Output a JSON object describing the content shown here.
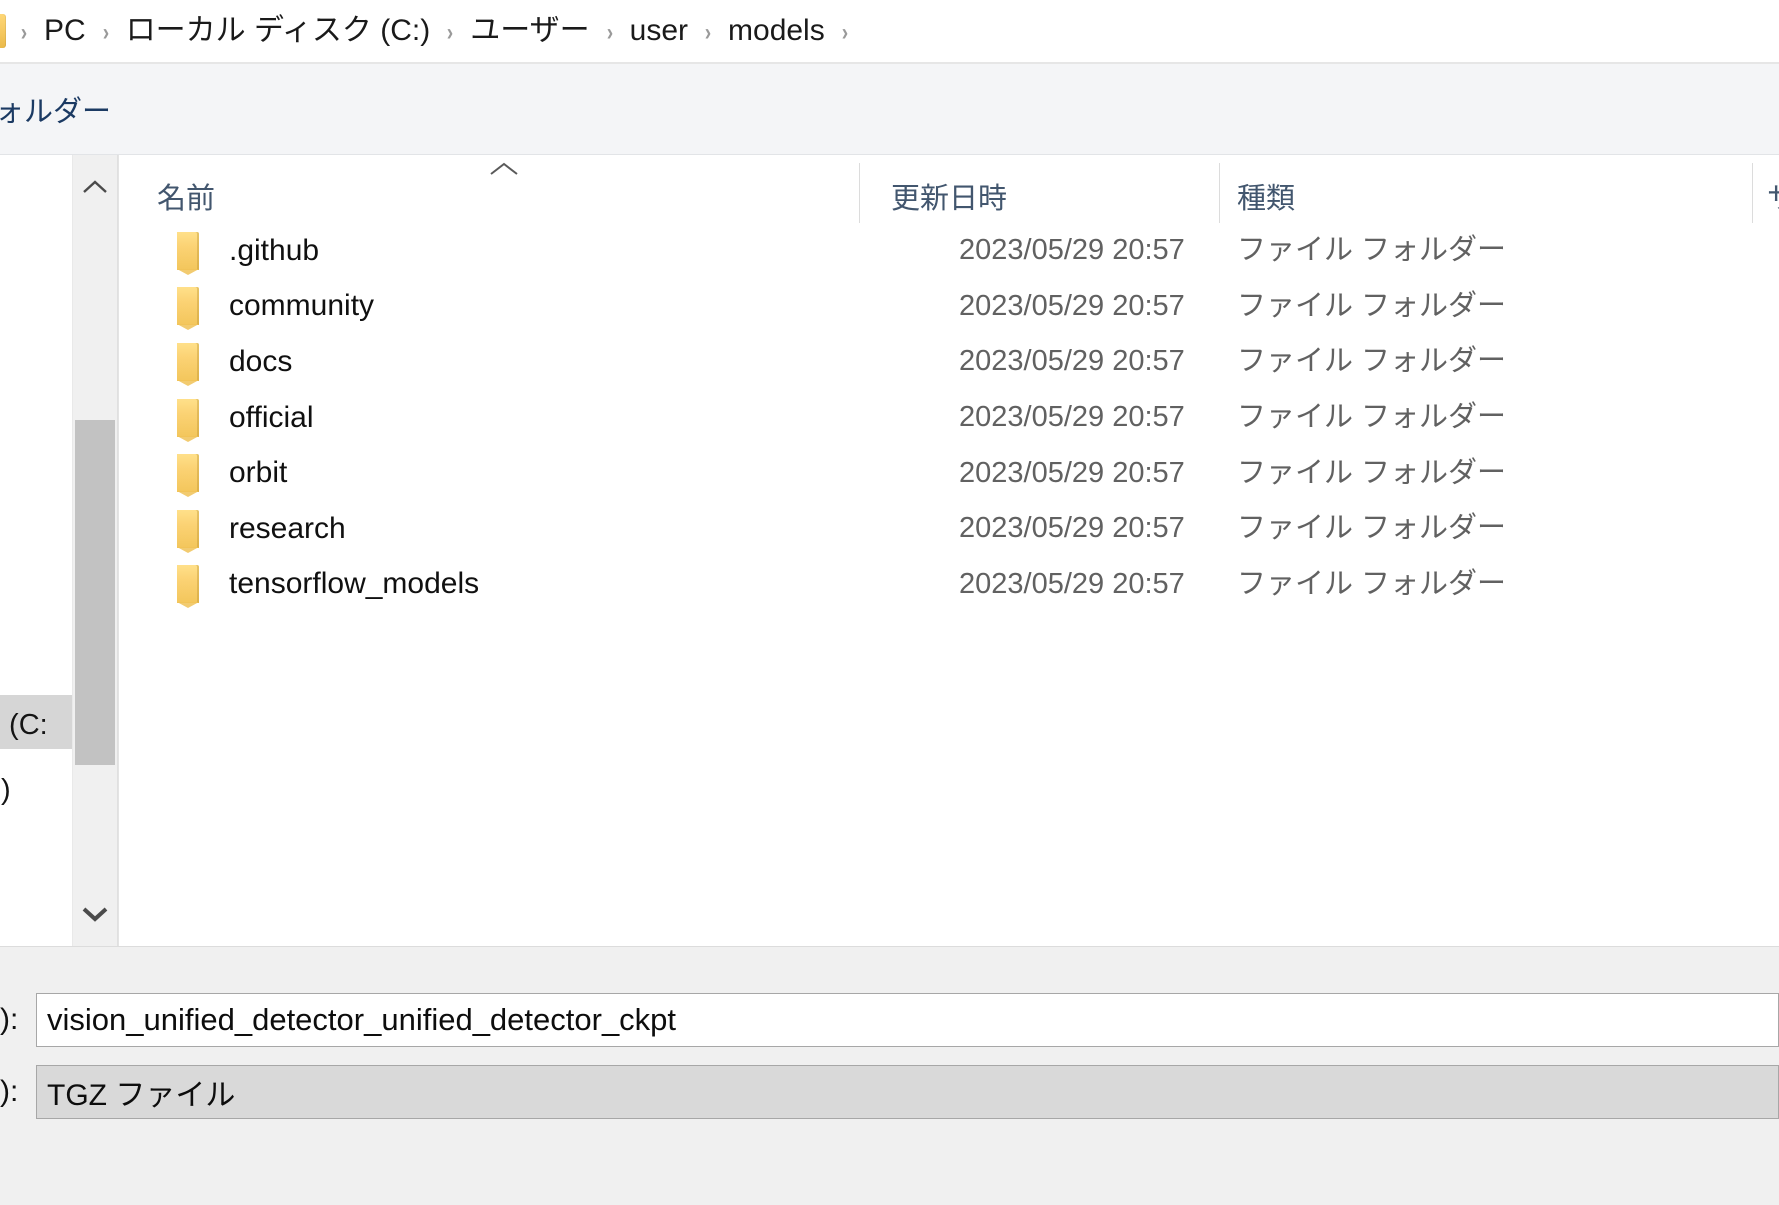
{
  "address_bar": {
    "folder_icon": "folder-icon",
    "breadcrumbs": [
      "PC",
      "ローカル ディスク (C:)",
      "ユーザー",
      "user",
      "models"
    ],
    "separator": "›"
  },
  "toolbar": {
    "new_folder_label": "フォルダー"
  },
  "nav_pane": {
    "items": [
      {
        "label": "ク (C:",
        "selected": true
      },
      {
        "label": "D:)",
        "selected": false
      }
    ]
  },
  "nav_scrollbar": {
    "up_arrow": "chevron-up-icon",
    "down_arrow": "chevron-down-icon"
  },
  "file_list": {
    "columns": [
      {
        "key": "name",
        "label": "名前",
        "sort": "asc"
      },
      {
        "key": "modified",
        "label": "更新日時",
        "sort": ""
      },
      {
        "key": "type",
        "label": "種類",
        "sort": ""
      },
      {
        "key": "size",
        "label": "サ",
        "sort": ""
      }
    ],
    "rows": [
      {
        "icon": "folder-icon",
        "name": ".github",
        "modified": "2023/05/29 20:57",
        "type": "ファイル フォルダー",
        "size": ""
      },
      {
        "icon": "folder-icon",
        "name": "community",
        "modified": "2023/05/29 20:57",
        "type": "ファイル フォルダー",
        "size": ""
      },
      {
        "icon": "folder-icon",
        "name": "docs",
        "modified": "2023/05/29 20:57",
        "type": "ファイル フォルダー",
        "size": ""
      },
      {
        "icon": "folder-icon",
        "name": "official",
        "modified": "2023/05/29 20:57",
        "type": "ファイル フォルダー",
        "size": ""
      },
      {
        "icon": "folder-icon",
        "name": "orbit",
        "modified": "2023/05/29 20:57",
        "type": "ファイル フォルダー",
        "size": ""
      },
      {
        "icon": "folder-icon",
        "name": "research",
        "modified": "2023/05/29 20:57",
        "type": "ファイル フォルダー",
        "size": ""
      },
      {
        "icon": "folder-icon",
        "name": "tensorflow_models",
        "modified": "2023/05/29 20:57",
        "type": "ファイル フォルダー",
        "size": ""
      }
    ]
  },
  "bottom": {
    "filename_label": "):",
    "filename_value": "vision_unified_detector_unified_detector_ckpt",
    "filetype_label": "):",
    "filetype_value": "TGZ ファイル"
  },
  "colors": {
    "header_text": "#42566e",
    "row_text": "#101010",
    "secondary_text": "#616161",
    "folder_yellow": "#f5c860",
    "toolbar_bg": "#f4f5f7",
    "bottom_bg": "#f0f0f0",
    "selection_gray": "#d6d6d6"
  }
}
